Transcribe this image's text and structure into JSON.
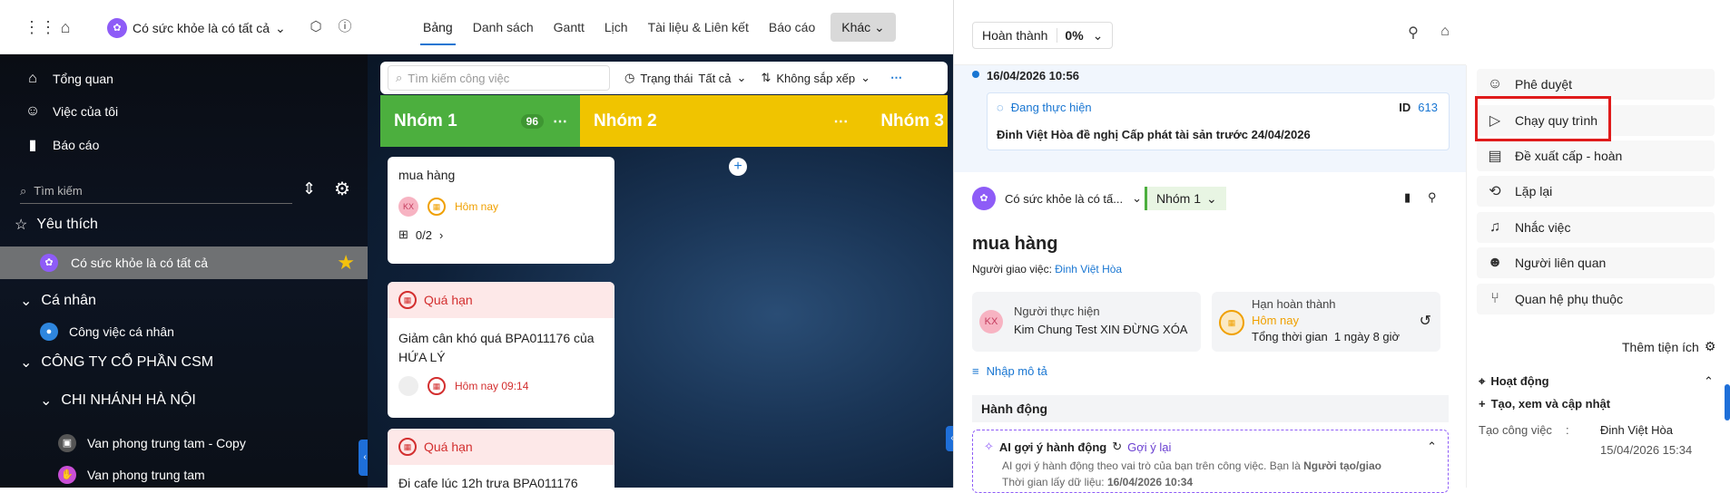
{
  "topbar": {
    "workspace": "Có sức khỏe là có tất cả",
    "tabs": [
      "Bảng",
      "Danh sách",
      "Gantt",
      "Lịch",
      "Tài liệu & Liên kết",
      "Báo cáo"
    ],
    "more": "Khác"
  },
  "sidebar": {
    "nav": [
      "Tổng quan",
      "Việc của tôi",
      "Báo cáo"
    ],
    "search_placeholder": "Tìm kiếm",
    "favorites": "Yêu thích",
    "fav_item": "Có sức khỏe là có tất cả",
    "personal": "Cá nhân",
    "personal_item": "Công việc cá nhân",
    "company": "CÔNG TY CỔ PHẦN CSM",
    "branch": "CHI NHÁNH HÀ NỘI",
    "offices": [
      "Van phong trung tam - Copy",
      "Van phong trung tam"
    ]
  },
  "board": {
    "search_placeholder": "Tìm kiếm công việc",
    "status_label": "Trạng thái",
    "status_value": "Tất cả",
    "sort": "Không sắp xếp",
    "columns": [
      {
        "name": "Nhóm 1",
        "count": "96",
        "color": "#4caf3e"
      },
      {
        "name": "Nhóm 2",
        "color": "#f0c400"
      },
      {
        "name": "Nhóm 3",
        "color": "#f0c400"
      }
    ],
    "cards": [
      {
        "title": "mua hàng",
        "avatar": "KX",
        "due": "Hôm nay",
        "subtasks": "0/2"
      },
      {
        "tag": "Quá hạn",
        "title": "Giảm cân khó quá BPA011176 của HỨA LÝ",
        "due": "Hôm nay 09:14"
      },
      {
        "tag": "Quá hạn",
        "title": "Đi cafe lúc 12h trưa BPA011176"
      }
    ]
  },
  "detail": {
    "status": "Hoàn thành",
    "percent": "0%",
    "history_time": "16/04/2026 10:56",
    "history_state": "Đang thực hiện",
    "history_id_label": "ID",
    "history_id": "613",
    "history_text": "Đinh Việt Hòa đề nghị Cấp phát tài sản trước 24/04/2026",
    "project": "Có sức khỏe là có tấ...",
    "group": "Nhóm 1",
    "title": "mua hàng",
    "assigner_label": "Người giao việc:",
    "assigner": "Đinh Việt Hòa",
    "doer_label": "Người thực hiện",
    "doer_avatar": "KX",
    "doer": "Kim Chung Test XIN ĐỪNG XÓA",
    "due_label": "Hạn hoàn thành",
    "due": "Hôm nay",
    "total_label": "Tổng thời gian",
    "total": "1 ngày 8 giờ",
    "desc": "Nhập mô tả",
    "actions": "Hành động",
    "ai_title": "AI gợi ý hành động",
    "ai_retry": "Gợi ý lại",
    "ai_text_1": "AI gợi ý hành động theo vai trò của bạn trên công việc. Bạn là",
    "ai_role": "Người tạo/giao",
    "ai_time_label": "Thời gian lấy dữ liệu:",
    "ai_time": "16/04/2026 10:34"
  },
  "rmenu": {
    "items": [
      "Phê duyệt",
      "Chạy quy trình",
      "Đề xuất cấp - hoàn",
      "Lặp lại",
      "Nhắc việc",
      "Người liên quan",
      "Quan hệ phụ thuộc"
    ],
    "more": "Thêm tiện ích",
    "activity": "Hoạt động",
    "create_view": "Tạo, xem và cập nhật",
    "create_label": "Tạo công việc",
    "creator": "Đinh Việt Hòa",
    "created_time": "15/04/2026 15:34"
  }
}
